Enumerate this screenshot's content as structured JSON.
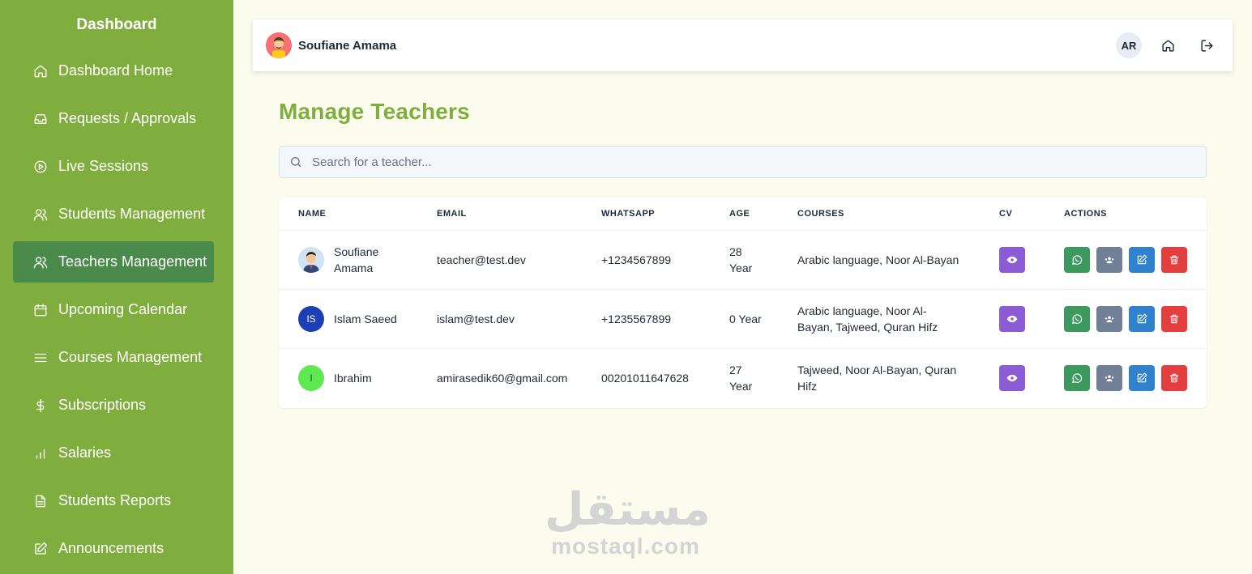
{
  "sidebar": {
    "title": "Dashboard",
    "items": [
      {
        "label": "Dashboard Home",
        "icon": "home-icon",
        "active": false
      },
      {
        "label": "Requests / Approvals",
        "icon": "inbox-icon",
        "active": false
      },
      {
        "label": "Live Sessions",
        "icon": "play-circle-icon",
        "active": false
      },
      {
        "label": "Students Management",
        "icon": "users-icon",
        "active": false
      },
      {
        "label": "Teachers Management",
        "icon": "users-icon",
        "active": true
      },
      {
        "label": "Upcoming Calendar",
        "icon": "calendar-icon",
        "active": false
      },
      {
        "label": "Courses Management",
        "icon": "menu-icon",
        "active": false
      },
      {
        "label": "Subscriptions",
        "icon": "dollar-icon",
        "active": false
      },
      {
        "label": "Salaries",
        "icon": "bar-chart-icon",
        "active": false
      },
      {
        "label": "Students Reports",
        "icon": "file-text-icon",
        "active": false
      },
      {
        "label": "Announcements",
        "icon": "edit-icon",
        "active": false
      }
    ]
  },
  "header": {
    "user_name": "Soufiane Amama",
    "lang_label": "AR",
    "icons": [
      "home-icon",
      "logout-icon"
    ]
  },
  "main": {
    "title": "Manage Teachers",
    "search_placeholder": "Search for a teacher...",
    "columns": [
      "NAME",
      "EMAIL",
      "WHATSAPP",
      "AGE",
      "COURSES",
      "CV",
      "ACTIONS"
    ],
    "rows": [
      {
        "initials": "",
        "avatar_color": "#cfe3f2",
        "name": "Soufiane Amama",
        "email": "teacher@test.dev",
        "whatsapp": "+1234567899",
        "age": "28 Year",
        "courses": "Arabic language, Noor Al-Bayan"
      },
      {
        "initials": "IS",
        "avatar_color": "#1e3eb5",
        "name": "Islam Saeed",
        "email": "islam@test.dev",
        "whatsapp": "+1235567899",
        "age": "0 Year",
        "courses": "Arabic language, Noor Al-Bayan, Tajweed, Quran Hifz"
      },
      {
        "initials": "I",
        "avatar_color": "#5fe84f",
        "name": "Ibrahim",
        "email": "amirasedik60@gmail.com",
        "whatsapp": "00201011647628",
        "age": "27 Year",
        "courses": "Tajweed, Noor Al-Bayan, Quran Hifz"
      }
    ]
  },
  "watermark": {
    "arabic": "مستقل",
    "latin": "mostaql.com"
  },
  "colors": {
    "sidebar": "#7fad3e",
    "active_item": "#4a8a4a",
    "title": "#7fad3e",
    "cv": "#8b5cd6",
    "whatsapp": "#3d9a5f",
    "group": "#718096",
    "edit": "#3182ce",
    "delete": "#e53e3e"
  }
}
